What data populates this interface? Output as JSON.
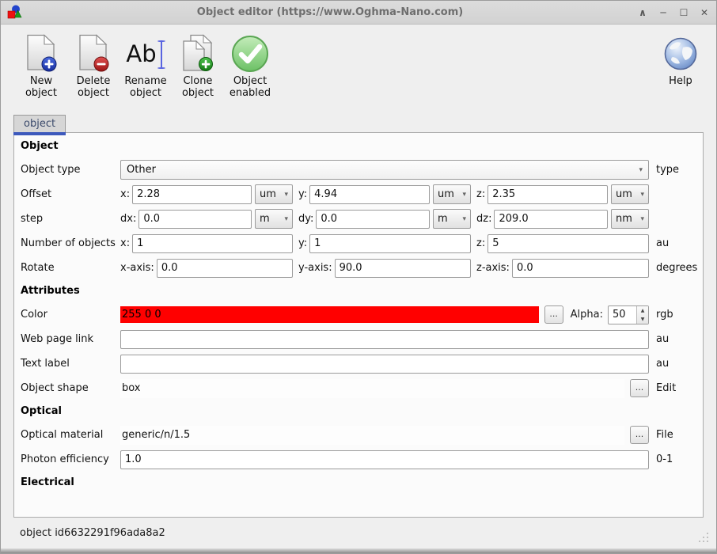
{
  "window": {
    "title": "Object editor (https://www.Oghma-Nano.com)",
    "controls": {
      "shade": "∧",
      "minimize": "─",
      "maximize": "☐",
      "close": "✕"
    }
  },
  "toolbar": {
    "new_object": {
      "line1": "New",
      "line2": "object",
      "icon": "document-plus"
    },
    "delete_object": {
      "line1": "Delete",
      "line2": "object",
      "icon": "document-minus"
    },
    "rename_object": {
      "line1": "Rename",
      "line2": "object",
      "icon": "text-cursor",
      "glyph": "Ab"
    },
    "clone_object": {
      "line1": "Clone",
      "line2": "object",
      "icon": "documents-plus"
    },
    "object_enabled": {
      "line1": "Object",
      "line2": "enabled",
      "icon": "green-check"
    },
    "help": {
      "label": "Help",
      "icon": "globe"
    }
  },
  "tab": {
    "label": "object"
  },
  "form": {
    "section_object": "Object",
    "object_type": {
      "label": "Object type",
      "value": "Other",
      "unit": "type"
    },
    "offset": {
      "label": "Offset",
      "x_label": "x:",
      "x": "2.28",
      "x_unit": "um",
      "y_label": "y:",
      "y": "4.94",
      "y_unit": "um",
      "z_label": "z:",
      "z": "2.35",
      "z_unit": "um"
    },
    "step": {
      "label": "step",
      "x_label": "dx:",
      "x": "0.0",
      "x_unit": "m",
      "y_label": "dy:",
      "y": "0.0",
      "y_unit": "m",
      "z_label": "dz:",
      "z": "209.0",
      "z_unit": "nm"
    },
    "number_of_objects": {
      "label": "Number of objects",
      "x_label": "x:",
      "x": "1",
      "y_label": "y:",
      "y": "1",
      "z_label": "z:",
      "z": "5",
      "unit": "au"
    },
    "rotate": {
      "label": "Rotate",
      "x_label": "x-axis:",
      "x": "0.0",
      "y_label": "y-axis:",
      "y": "90.0",
      "z_label": "z-axis:",
      "z": "0.0",
      "unit": "degrees"
    },
    "section_attributes": "Attributes",
    "color": {
      "label": "Color",
      "value": "255 0 0",
      "swatch_hex": "#ff0000",
      "browse": "...",
      "alpha_label": "Alpha:",
      "alpha": "50",
      "unit": "rgb"
    },
    "web_page_link": {
      "label": "Web page link",
      "value": "",
      "unit": "au"
    },
    "text_label": {
      "label": "Text label",
      "value": "",
      "unit": "au"
    },
    "object_shape": {
      "label": "Object shape",
      "value": "box",
      "browse": "...",
      "unit": "Edit"
    },
    "section_optical": "Optical",
    "optical_material": {
      "label": "Optical material",
      "value": "generic/n/1.5",
      "browse": "...",
      "unit": "File"
    },
    "photon_efficiency": {
      "label": "Photon efficiency",
      "value": "1.0",
      "unit": "0-1"
    },
    "section_electrical": "Electrical",
    "dropdown_arrow": "▾",
    "spin_up": "▲",
    "spin_down": "▼"
  },
  "statusbar": {
    "text": "object id6632291f96ada8a2"
  },
  "colors": {
    "tab_accent": "#3d59bc",
    "title_text": "#6e6e6e",
    "swatch": "#ff0000"
  }
}
